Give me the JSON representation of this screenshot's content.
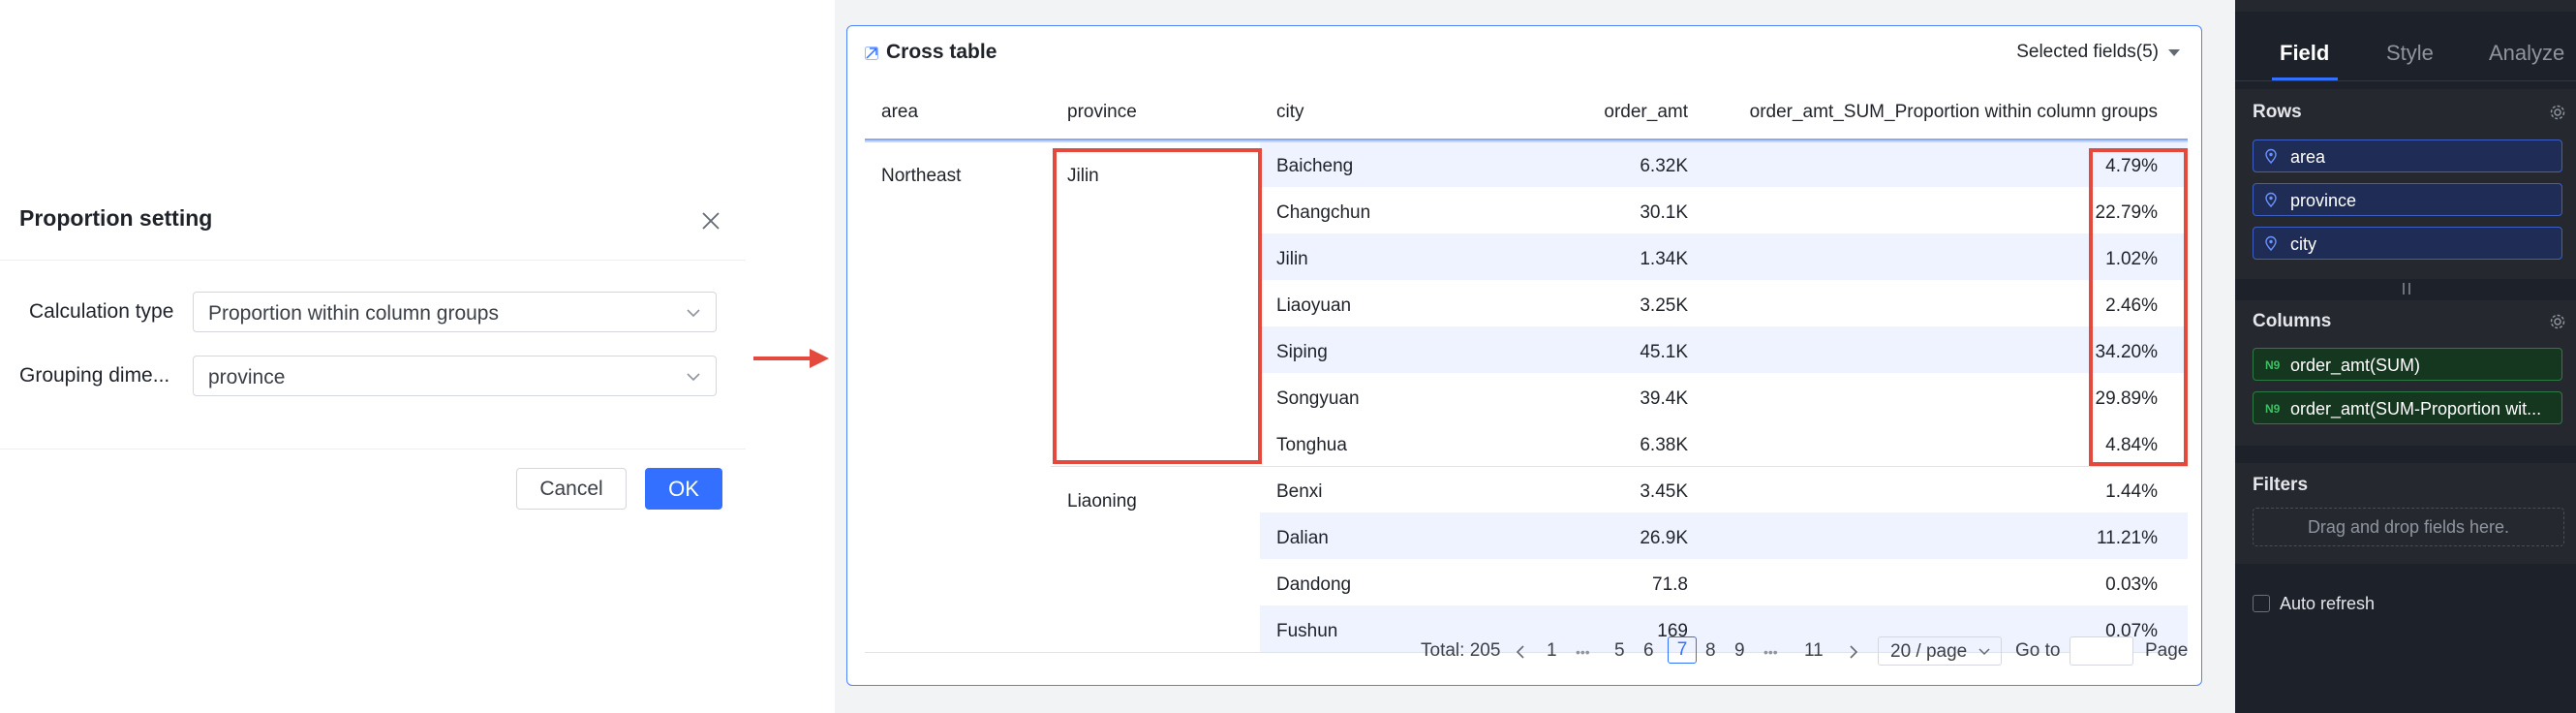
{
  "dialog": {
    "title": "Proportion setting",
    "calc_label": "Calculation type",
    "calc_value": "Proportion within column groups",
    "group_label": "Grouping dime...",
    "group_value": "province",
    "cancel": "Cancel",
    "ok": "OK"
  },
  "card": {
    "title": "Cross table",
    "selected_fields": "Selected fields(5)",
    "headers": {
      "area": "area",
      "province": "province",
      "city": "city",
      "order_amt": "order_amt",
      "proportion": "order_amt_SUM_Proportion within column groups"
    },
    "area": "Northeast",
    "provinces": [
      "Jilin",
      "Liaoning"
    ],
    "rows": [
      {
        "city": "Baicheng",
        "amt": "6.32K",
        "prop": "4.79%"
      },
      {
        "city": "Changchun",
        "amt": "30.1K",
        "prop": "22.79%"
      },
      {
        "city": "Jilin",
        "amt": "1.34K",
        "prop": "1.02%"
      },
      {
        "city": "Liaoyuan",
        "amt": "3.25K",
        "prop": "2.46%"
      },
      {
        "city": "Siping",
        "amt": "45.1K",
        "prop": "34.20%"
      },
      {
        "city": "Songyuan",
        "amt": "39.4K",
        "prop": "29.89%"
      },
      {
        "city": "Tonghua",
        "amt": "6.38K",
        "prop": "4.84%"
      },
      {
        "city": "Benxi",
        "amt": "3.45K",
        "prop": "1.44%"
      },
      {
        "city": "Dalian",
        "amt": "26.9K",
        "prop": "11.21%"
      },
      {
        "city": "Dandong",
        "amt": "71.8",
        "prop": "0.03%"
      },
      {
        "city": "Fushun",
        "amt": "169",
        "prop": "0.07%"
      }
    ],
    "pager": {
      "total": "Total: 205",
      "p1": "1",
      "ellipsis": "•••",
      "p5": "5",
      "p6": "6",
      "p7": "7",
      "p8": "8",
      "p9": "9",
      "p11": "11",
      "page_size": "20 / page",
      "goto": "Go to",
      "page": "Page"
    }
  },
  "panel": {
    "tabs": [
      "Field",
      "Style",
      "Analyze"
    ],
    "rows_title": "Rows",
    "row_fields": [
      "area",
      "province",
      "city"
    ],
    "columns_title": "Columns",
    "column_fields": [
      "order_amt(SUM)",
      "order_amt(SUM-Proportion wit..."
    ],
    "measure_badge": "N9",
    "filters_title": "Filters",
    "drop_hint": "Drag and drop fields here.",
    "auto_refresh": "Auto refresh"
  },
  "colors": {
    "accent": "#3370ff",
    "highlight": "#e4493e",
    "panel_bg": "#1d2129"
  }
}
